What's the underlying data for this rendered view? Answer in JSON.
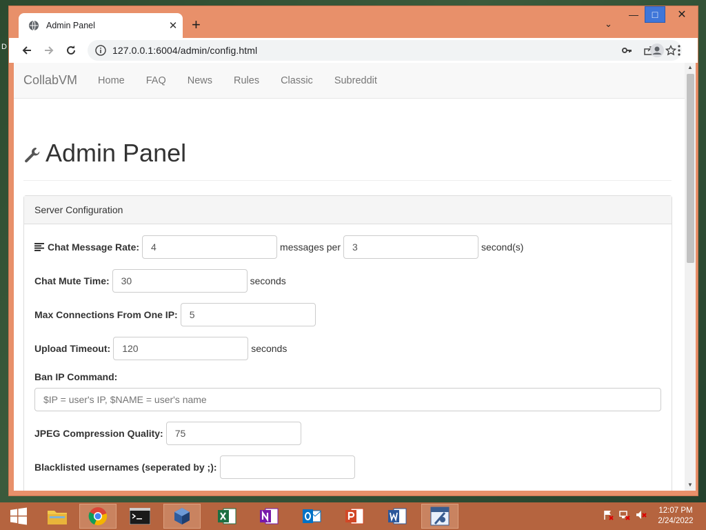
{
  "browser": {
    "tab_title": "Admin Panel",
    "tab_close": "✕",
    "new_tab": "+",
    "tab_search": "⌄",
    "window_min": "—",
    "window_max": "□",
    "window_close": "✕",
    "url": "127.0.0.1:6004/admin/config.html"
  },
  "navbar": {
    "brand": "CollabVM",
    "links": [
      "Home",
      "FAQ",
      "News",
      "Rules",
      "Classic",
      "Subreddit"
    ]
  },
  "page": {
    "title": "Admin Panel"
  },
  "panel": {
    "heading": "Server Configuration",
    "chat_rate": {
      "label": "Chat Message Rate:",
      "messages": "4",
      "middle": "messages per",
      "seconds": "3",
      "unit": "second(s)"
    },
    "mute_time": {
      "label": "Chat Mute Time:",
      "value": "30",
      "unit": "seconds"
    },
    "max_conn": {
      "label": "Max Connections From One IP:",
      "value": "5"
    },
    "upload_timeout": {
      "label": "Upload Timeout:",
      "value": "120",
      "unit": "seconds"
    },
    "ban_ip": {
      "label": "Ban IP Command:",
      "placeholder": "$IP = user's IP, $NAME = user's name"
    },
    "jpeg": {
      "label": "JPEG Compression Quality:",
      "value": "75"
    },
    "blacklist": {
      "label": "Blacklisted usernames (seperated by ;):",
      "value": ""
    }
  },
  "taskbar": {
    "apps": [
      "start-icon",
      "file-explorer-icon",
      "chrome-icon",
      "command-prompt-icon",
      "virtualbox-icon",
      "excel-icon",
      "onenote-icon",
      "outlook-icon",
      "powerpoint-icon",
      "word-icon",
      "snipping-app-icon"
    ],
    "time": "12:07 PM",
    "date": "2/24/2022"
  },
  "desktop": {
    "edge_letter": "D"
  },
  "colors": {
    "window_frame": "#e8906a",
    "taskbar": "#b5643f",
    "maximize_button": "#3f76d9"
  }
}
